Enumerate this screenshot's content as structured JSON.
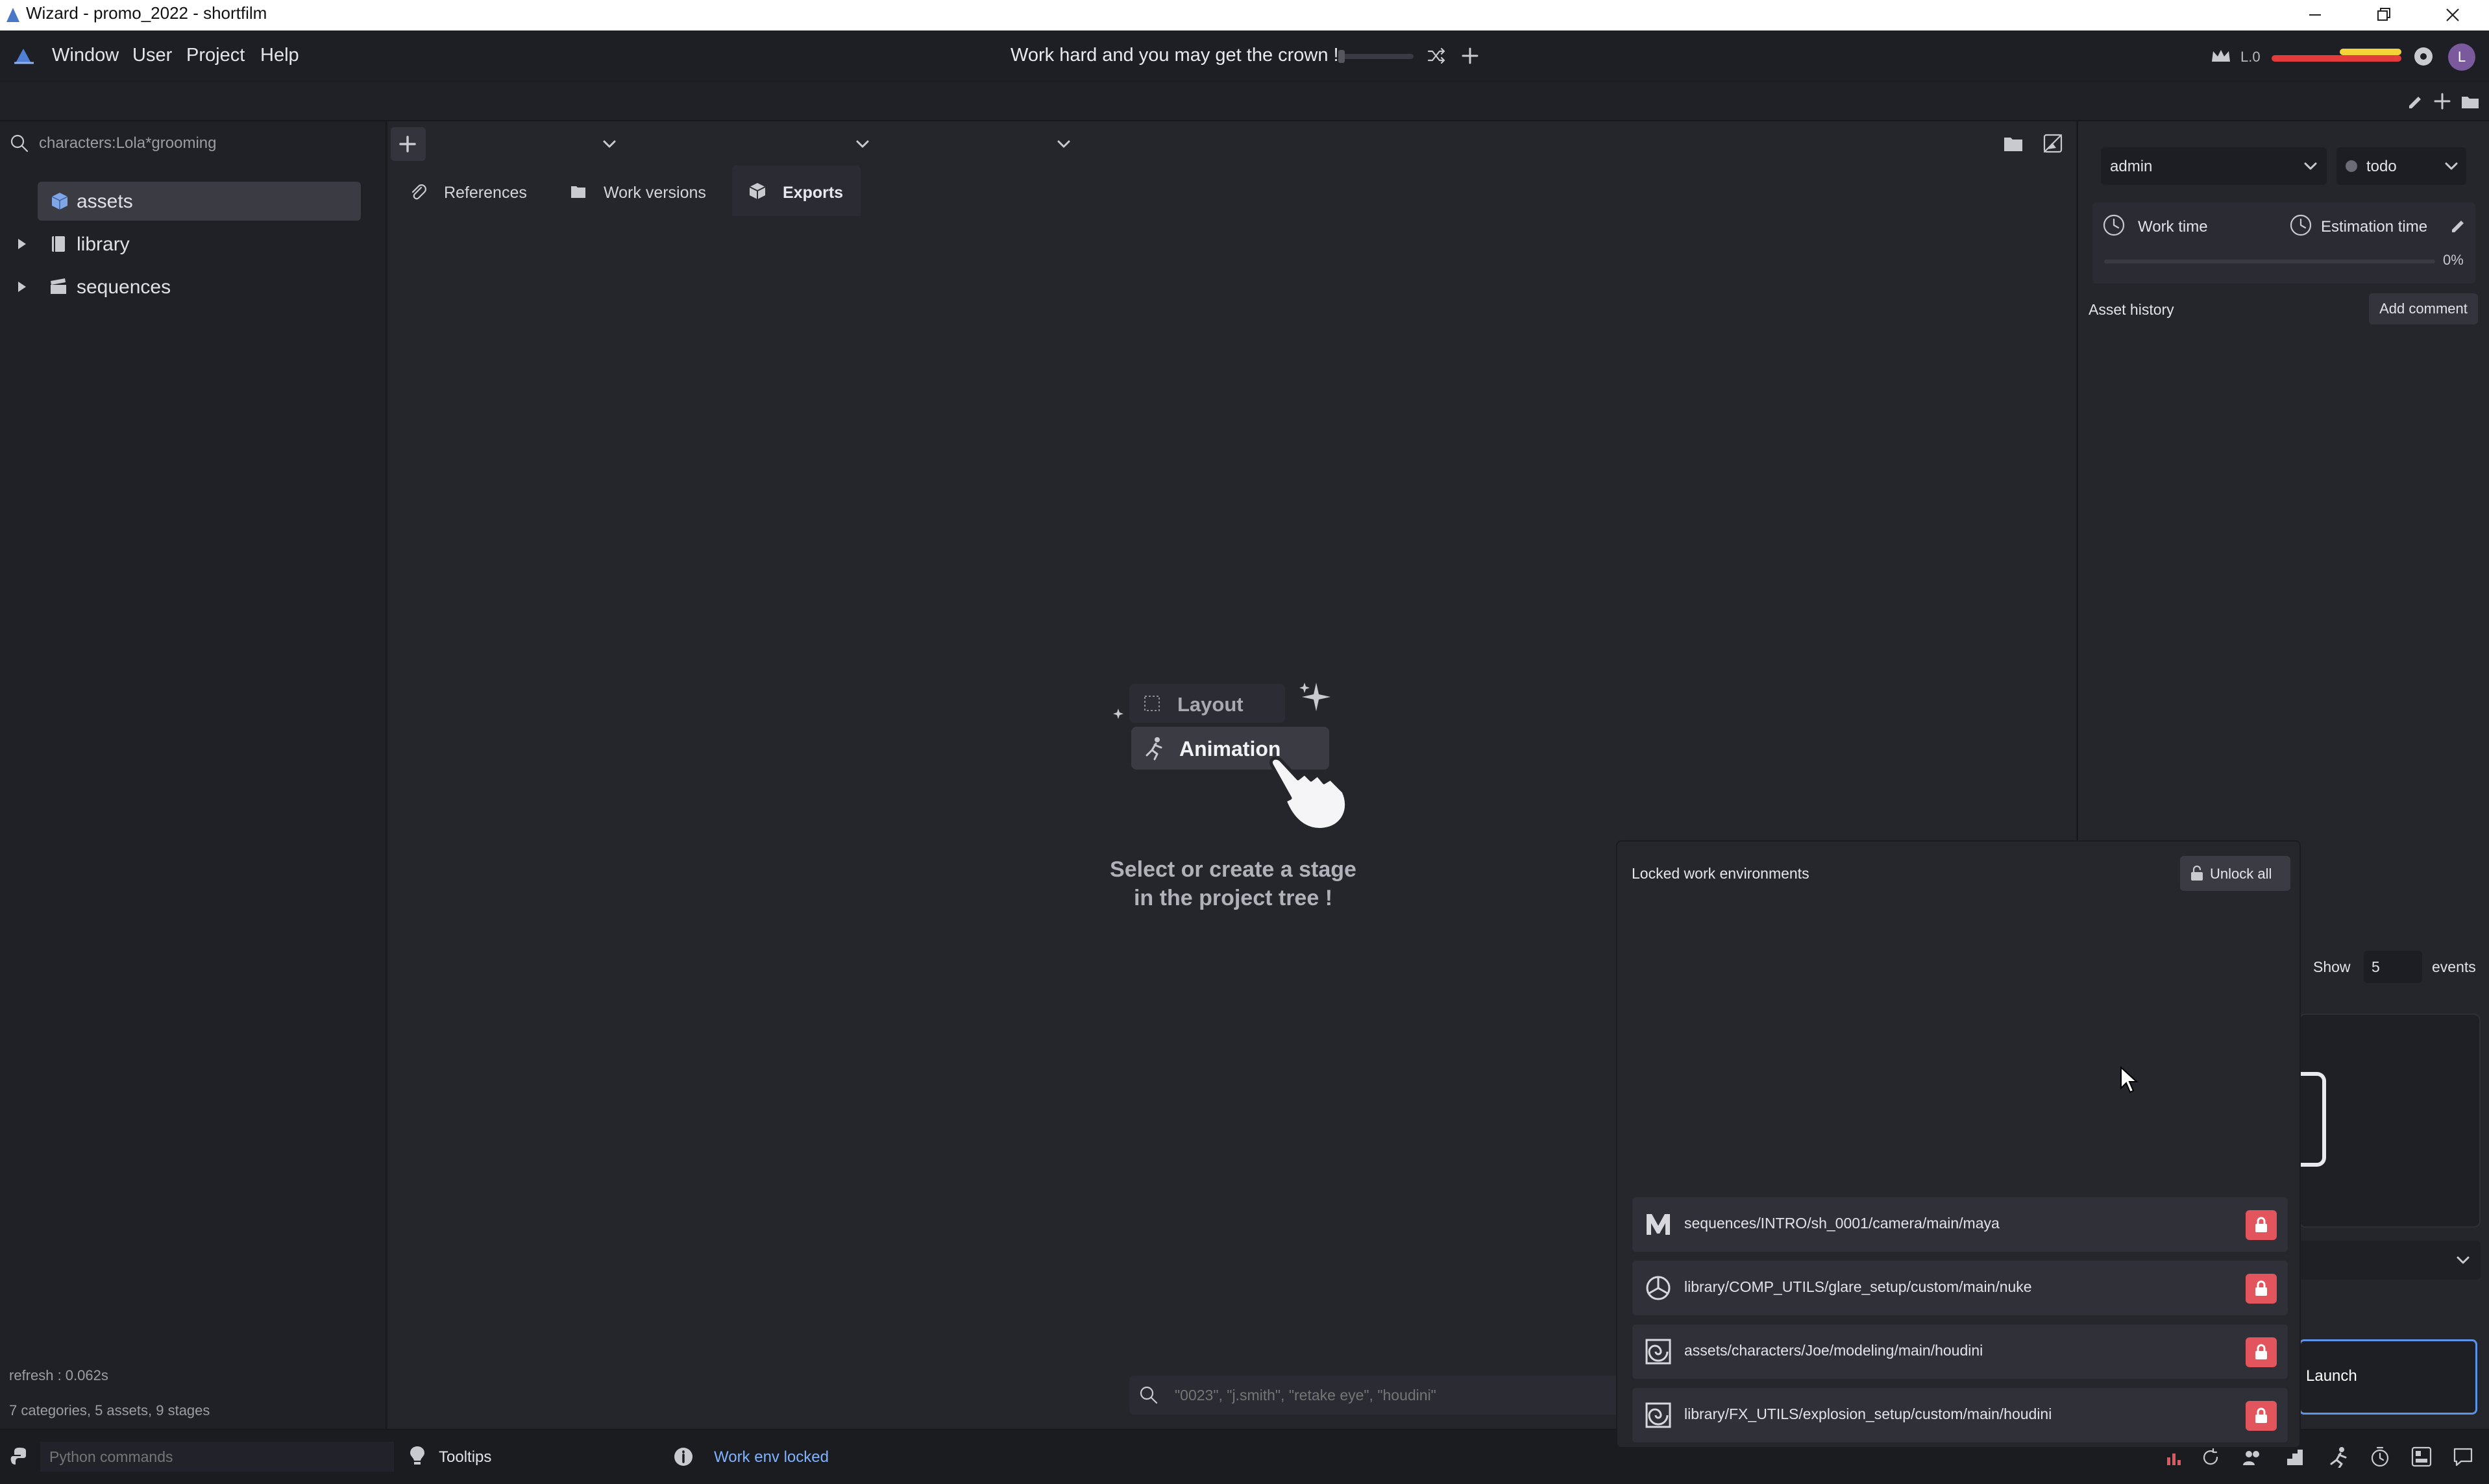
{
  "window": {
    "title": "Wizard - promo_2022 - shortfilm"
  },
  "menu": {
    "items": [
      "Window",
      "User",
      "Project",
      "Help"
    ]
  },
  "header": {
    "quote": "Work hard and you may get the crown !",
    "level": "L.0",
    "avatar": "L"
  },
  "tree": {
    "search_value": "characters:Lola*grooming",
    "items": [
      {
        "label": "assets",
        "icon": "cube-icon",
        "selected": true
      },
      {
        "label": "library",
        "icon": "book-icon",
        "selected": false
      },
      {
        "label": "sequences",
        "icon": "clapper-icon",
        "selected": false
      }
    ],
    "refresh": "refresh : 0.062s",
    "summary": "7 categories, 5 assets, 9 stages"
  },
  "tabs": [
    {
      "label": "References",
      "icon": "paperclip-icon",
      "active": false
    },
    {
      "label": "Work versions",
      "icon": "folder-stack-icon",
      "active": false
    },
    {
      "label": "Exports",
      "icon": "box-icon",
      "active": true
    }
  ],
  "empty_state": {
    "stage1": "Layout",
    "stage2": "Animation",
    "line1": "Select or create a stage",
    "line2": "in the project tree !"
  },
  "center_search": {
    "placeholder": "\"0023\", \"j.smith\", \"retake eye\", \"houdini\""
  },
  "right": {
    "user": "admin",
    "state": "todo",
    "work_time": "Work time",
    "estimation_time": "Estimation time",
    "percent": "0%",
    "history": "Asset history",
    "add_comment": "Add comment",
    "show_label": "Show",
    "show_value": "5",
    "events_label": "events",
    "launch": "Launch"
  },
  "popup": {
    "title": "Locked work environments",
    "unlock_all": "Unlock all",
    "rows": [
      {
        "path": "sequences/INTRO/sh_0001/camera/main/maya",
        "icon": "maya-icon"
      },
      {
        "path": "library/COMP_UTILS/glare_setup/custom/main/nuke",
        "icon": "nuke-icon"
      },
      {
        "path": "assets/characters/Joe/modeling/main/houdini",
        "icon": "houdini-icon"
      },
      {
        "path": "library/FX_UTILS/explosion_setup/custom/main/houdini",
        "icon": "houdini-icon"
      }
    ]
  },
  "status": {
    "python_placeholder": "Python commands",
    "tooltips": "Tooltips",
    "message": "Work env locked"
  },
  "colors": {
    "accent_blue": "#5b93e6",
    "lock_red": "#e2555c",
    "status_blue": "#7fb2ff",
    "xp_red": "#e43b3b",
    "xp_yellow": "#f4d23a"
  }
}
